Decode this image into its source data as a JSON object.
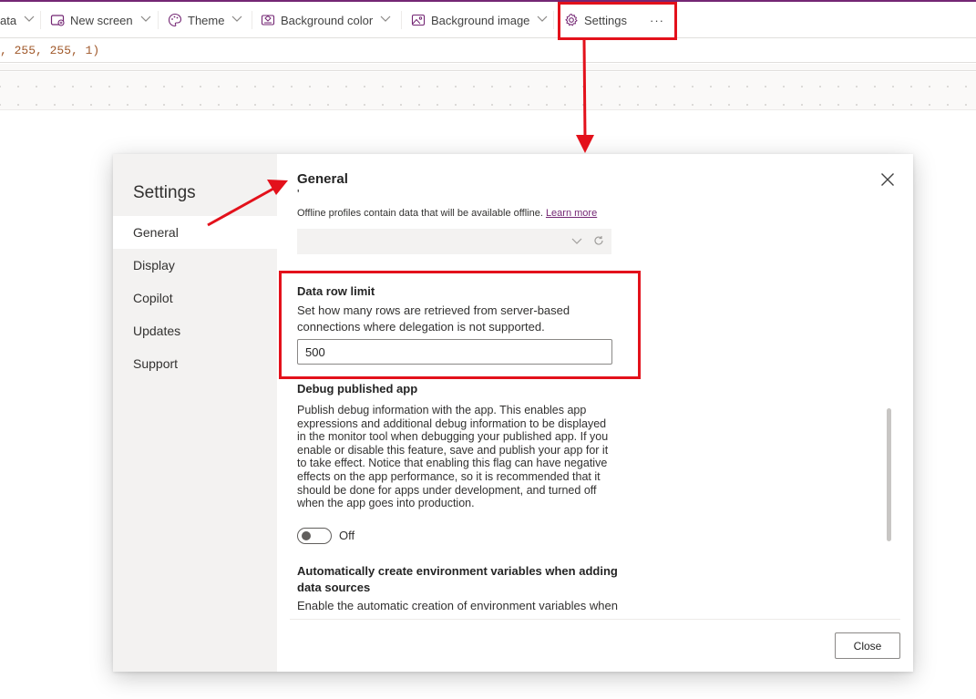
{
  "toolbar": {
    "items": [
      {
        "label": "ata",
        "icon": "chevron-down-icon"
      },
      {
        "label": "New screen",
        "icon": "new-screen-icon"
      },
      {
        "label": "Theme",
        "icon": "palette-icon"
      },
      {
        "label": "Background color",
        "icon": "paint-bucket-icon"
      },
      {
        "label": "Background image",
        "icon": "image-icon"
      },
      {
        "label": "Settings",
        "icon": "gear-icon"
      },
      {
        "label": "···",
        "icon": "more-icon"
      }
    ]
  },
  "formula_bar": {
    "value": ", 255, 255, 1)"
  },
  "colors": {
    "accent": "#742774",
    "callout_red": "#e3111b",
    "nav_bg": "#f3f2f1"
  },
  "dialog": {
    "title": "Settings",
    "nav": [
      "General",
      "Display",
      "Copilot",
      "Updates",
      "Support"
    ],
    "active_nav": "General",
    "section_title": "General",
    "cut_text": "'",
    "offline": {
      "text": "Offline profiles contain data that will be available offline.",
      "link": "Learn more"
    },
    "data_row_limit": {
      "label": "Data row limit",
      "description": "Set how many rows are retrieved from server-based connections where delegation is not supported.",
      "value": "500"
    },
    "debug": {
      "label": "Debug published app",
      "description": "Publish debug information with the app. This enables app expressions and additional debug information to be displayed in the monitor tool when debugging your published app. If you enable or disable this feature, save and publish your app for it to take effect. Notice that enabling this flag can have negative effects on the app performance, so it is recommended that it should be done for apps under development, and turned off when the app goes into production.",
      "toggle_state": "Off"
    },
    "env_vars": {
      "label": "Automatically create environment variables when adding data sources",
      "cut_text": "Enable the automatic creation of environment variables when"
    },
    "close_button": "Close"
  }
}
